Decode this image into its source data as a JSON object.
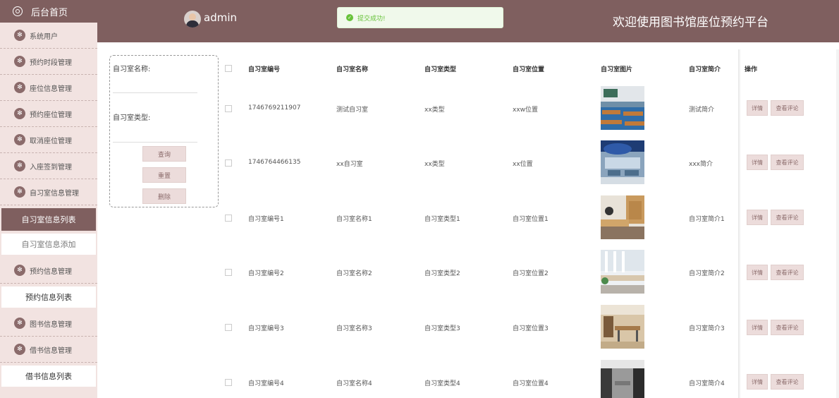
{
  "sidebar": {
    "home": "后台首页",
    "items": [
      "系统用户",
      "预约时段管理",
      "座位信息管理",
      "预约座位管理",
      "取消座位管理",
      "入座签到管理",
      "自习室信息管理"
    ],
    "sub_active": "自习室信息列表",
    "sub_add": "自习室信息添加",
    "item_reserve": "预约信息管理",
    "sub_reserve": "预约信息列表",
    "item_book": "图书信息管理",
    "item_borrow": "借书信息管理",
    "sub_borrow": "借书信息列表"
  },
  "header": {
    "username": "admin",
    "title": "欢迎使用图书馆座位预约平台"
  },
  "toast": {
    "message": "提交成功!"
  },
  "search": {
    "name_label": "自习室名称:",
    "type_label": "自习室类型:",
    "query_button": "查询",
    "reset_button": "重置",
    "delete_button": "删除"
  },
  "table": {
    "headers": [
      "自习室编号",
      "自习室名称",
      "自习室类型",
      "自习室位置",
      "自习室图片",
      "自习室简介",
      "操作"
    ],
    "rows": [
      {
        "no": "1746769211907",
        "name": "测试自习室",
        "type": "xx类型",
        "loc": "xxw位置",
        "intro": "测试简介"
      },
      {
        "no": "1746764466135",
        "name": "xx自习室",
        "type": "xx类型",
        "loc": "xx位置",
        "intro": "xxx简介"
      },
      {
        "no": "自习室编号1",
        "name": "自习室名称1",
        "type": "自习室类型1",
        "loc": "自习室位置1",
        "intro": "自习室简介1"
      },
      {
        "no": "自习室编号2",
        "name": "自习室名称2",
        "type": "自习室类型2",
        "loc": "自习室位置2",
        "intro": "自习室简介2"
      },
      {
        "no": "自习室编号3",
        "name": "自习室名称3",
        "type": "自习室类型3",
        "loc": "自习室位置3",
        "intro": "自习室简介3"
      },
      {
        "no": "自习室编号4",
        "name": "自习室名称4",
        "type": "自习室类型4",
        "loc": "自习室位置4",
        "intro": "自习室简介4"
      }
    ],
    "detail_button": "详情",
    "comment_button": "查看评论"
  },
  "colors": {
    "brand": "#7f5f5f",
    "sidebar_bg": "#f2e3e1",
    "button_bg": "#ecdcdb",
    "success": "#67c23a"
  }
}
